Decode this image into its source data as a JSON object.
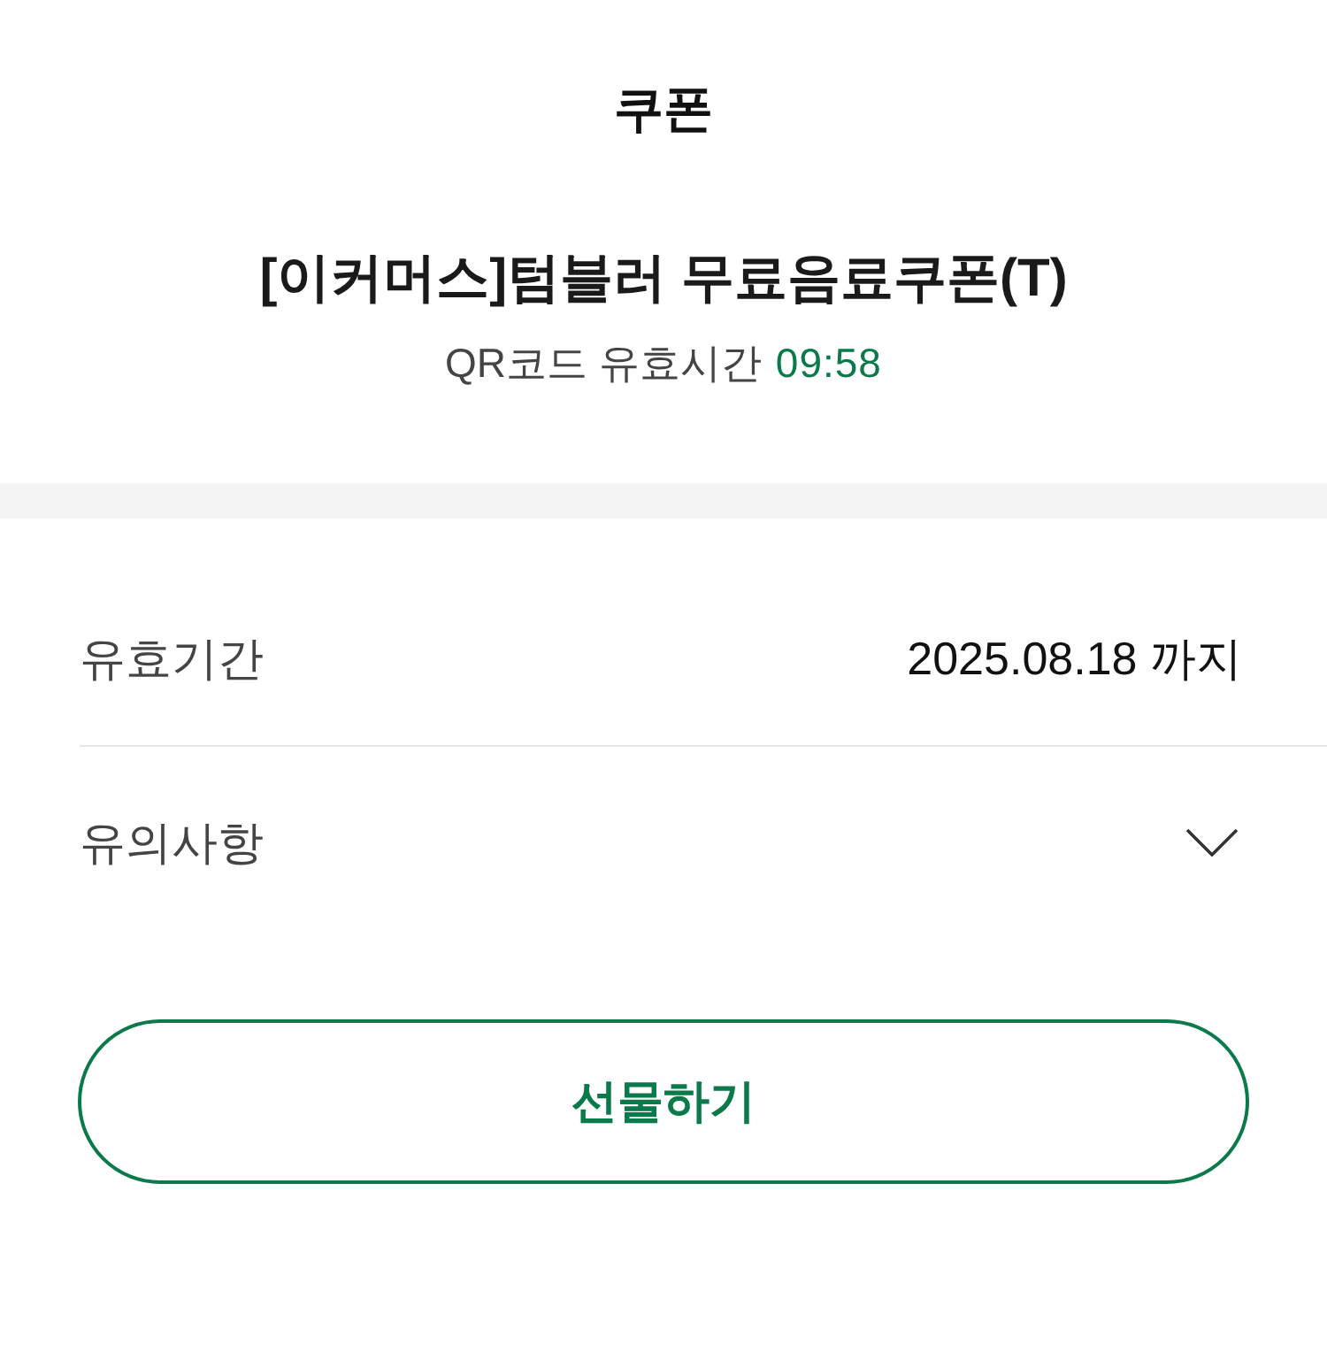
{
  "header": {
    "title": "쿠폰"
  },
  "coupon": {
    "name": "[이커머스]텀블러 무료음료쿠폰(T)",
    "qr_validity_label": "QR코드 유효시간",
    "qr_timer": "09:58"
  },
  "details": [
    {
      "kind": "value",
      "label": "유효기간",
      "value": "2025.08.18 까지"
    },
    {
      "kind": "expandable",
      "label": "유의사항",
      "expanded": false
    }
  ],
  "actions": [
    {
      "label": "선물하기"
    }
  ]
}
